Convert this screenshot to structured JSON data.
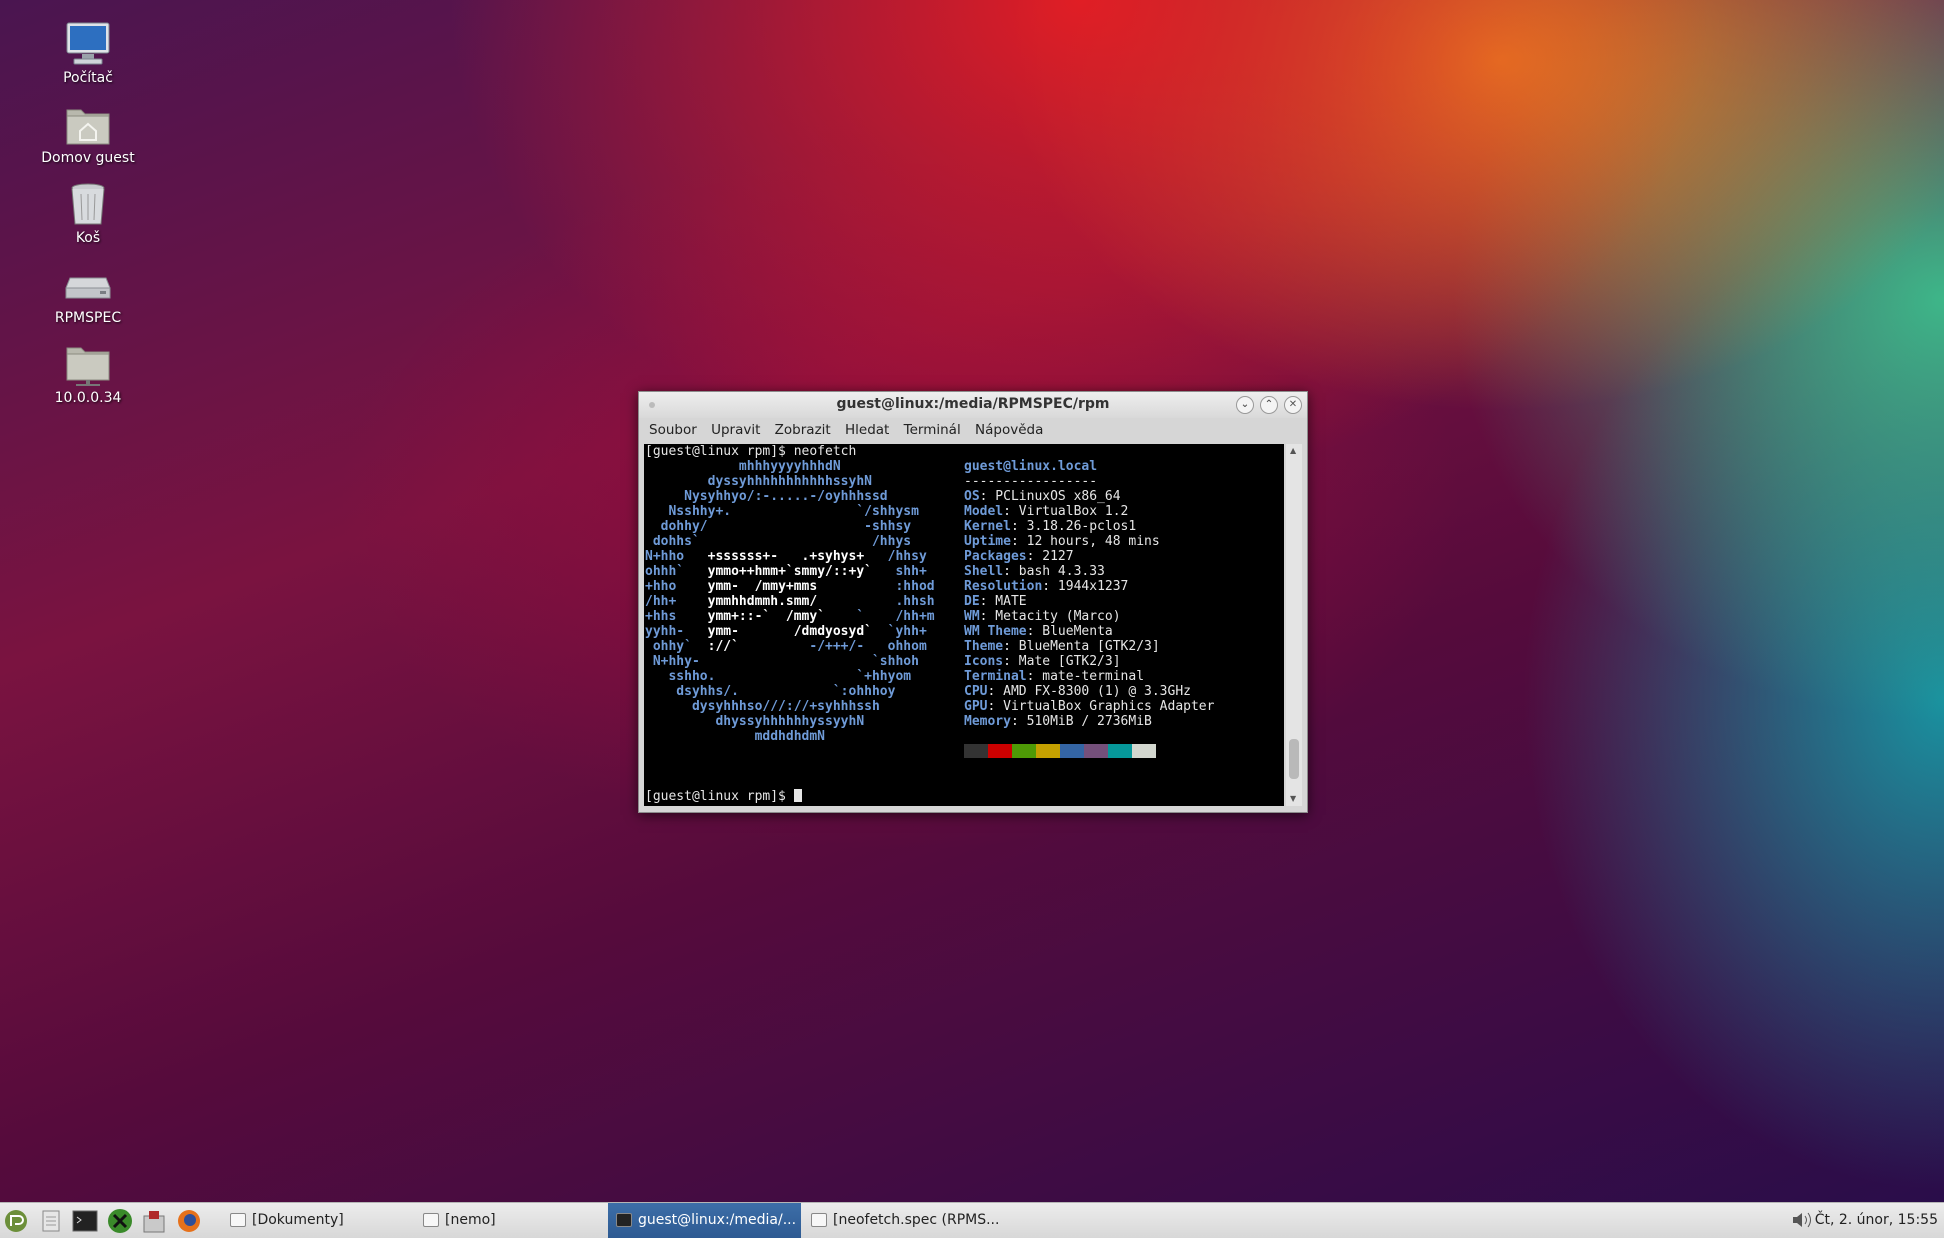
{
  "desktop": {
    "icons": [
      {
        "label": "Počítač",
        "icon": "computer-icon"
      },
      {
        "label": "Domov guest",
        "icon": "home-folder-icon"
      },
      {
        "label": "Koš",
        "icon": "trash-icon"
      },
      {
        "label": "RPMSPEC",
        "icon": "drive-icon"
      },
      {
        "label": "10.0.0.34",
        "icon": "network-share-icon"
      }
    ]
  },
  "terminal": {
    "title": "guest@linux:/media/RPMSPEC/rpm",
    "menu": [
      "Soubor",
      "Upravit",
      "Zobrazit",
      "Hledat",
      "Terminál",
      "Nápověda"
    ],
    "command_line": "[guest@linux rpm]$ neofetch",
    "prompt": "[guest@linux rpm]$ ",
    "logo_lines": [
      [
        "            mhhhyyyyhhhdN",
        "",
        ""
      ],
      [
        "        dyssyhhhhhhhhhhhssyhN",
        "",
        ""
      ],
      [
        "     Nysyhhyo/:-.....-/oyhhhssd",
        "",
        ""
      ],
      [
        "   Nsshhy+.                `/shhysm",
        "",
        ""
      ],
      [
        "  dohhy/                    -shhsy",
        "",
        ""
      ],
      [
        " dohhs`                      /hhys",
        "",
        ""
      ],
      [
        "N+hho   ",
        "+ssssss+-   .+syhys+",
        "   /hhsy"
      ],
      [
        "ohhh`   ",
        "ymmo++hmm+`smmy/::+y`",
        "   shh+"
      ],
      [
        "+hho    ",
        "ymm-  /mmy+mms",
        "          :hhod"
      ],
      [
        "/hh+    ",
        "ymmhhdmmh.smm/",
        "          .hhsh"
      ],
      [
        "+hhs    ",
        "ymm+::-`  /mmy`",
        "    `    /hh+m"
      ],
      [
        "yyhh-   ",
        "ymm-       /dmdyosyd`",
        "  `yhh+"
      ],
      [
        " ohhy`  ",
        "://`",
        "         -/+++/-   ohhom"
      ],
      [
        " N+hhy-                      `shhoh",
        "",
        ""
      ],
      [
        "   sshho.                  `+hhyom",
        "",
        ""
      ],
      [
        "    dsyhhs/.            `:ohhhoy",
        "",
        ""
      ],
      [
        "      dysyhhhso///://+syhhhssh",
        "",
        ""
      ],
      [
        "         dhyssyhhhhhhyssyyhN",
        "",
        ""
      ],
      [
        "              mddhdhdmN",
        "",
        ""
      ]
    ],
    "info": {
      "userhost": "guest@linux.local",
      "separator": "-----------------",
      "rows": [
        {
          "key": "OS",
          "value": "PCLinuxOS x86_64"
        },
        {
          "key": "Model",
          "value": "VirtualBox 1.2"
        },
        {
          "key": "Kernel",
          "value": "3.18.26-pclos1"
        },
        {
          "key": "Uptime",
          "value": "12 hours, 48 mins"
        },
        {
          "key": "Packages",
          "value": "2127"
        },
        {
          "key": "Shell",
          "value": "bash 4.3.33"
        },
        {
          "key": "Resolution",
          "value": "1944x1237"
        },
        {
          "key": "DE",
          "value": "MATE"
        },
        {
          "key": "WM",
          "value": "Metacity (Marco)"
        },
        {
          "key": "WM Theme",
          "value": "BlueMenta"
        },
        {
          "key": "Theme",
          "value": "BlueMenta [GTK2/3]"
        },
        {
          "key": "Icons",
          "value": "Mate [GTK2/3]"
        },
        {
          "key": "Terminal",
          "value": "mate-terminal"
        },
        {
          "key": "CPU",
          "value": "AMD FX-8300 (1) @ 3.3GHz"
        },
        {
          "key": "GPU",
          "value": "VirtualBox Graphics Adapter"
        },
        {
          "key": "Memory",
          "value": "510MiB / 2736MiB"
        }
      ],
      "palette": [
        "#333333",
        "#cc0000",
        "#4e9a06",
        "#c4a000",
        "#3465a4",
        "#75507b",
        "#06989a",
        "#d3d7cf"
      ]
    }
  },
  "taskbar": {
    "launchers": [
      "mate-menu-icon",
      "file-manager-icon",
      "terminal-icon",
      "xchat-icon",
      "software-center-icon",
      "firefox-icon"
    ],
    "tasks": [
      {
        "label": "[Dokumenty]",
        "active": false
      },
      {
        "label": "[nemo]",
        "active": false
      },
      {
        "label": "guest@linux:/media/...",
        "active": true
      },
      {
        "label": "[neofetch.spec (RPMS...",
        "active": false
      }
    ],
    "clock": "Čt,  2. únor, 15:55"
  }
}
